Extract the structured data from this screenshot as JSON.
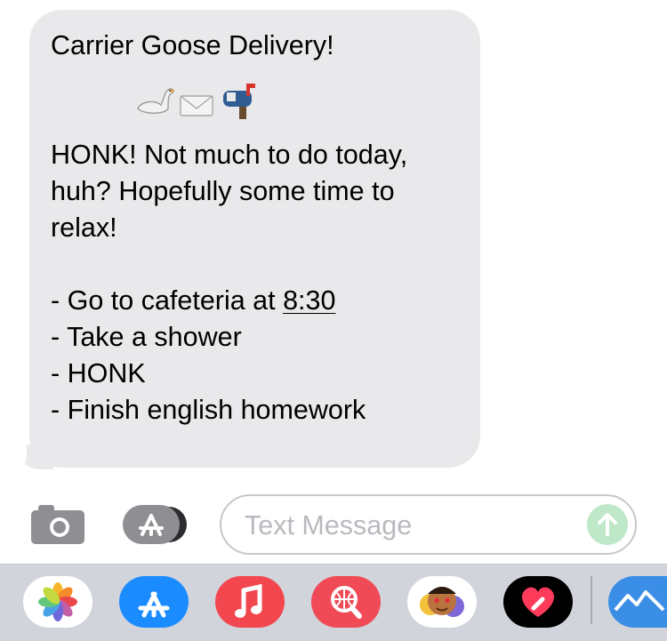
{
  "message": {
    "title": "Carrier Goose Delivery!",
    "emojis": [
      "swan",
      "envelope",
      "open-mailbox"
    ],
    "body_lines": [
      "HONK! Not much to do today,",
      "huh? Hopefully some time to",
      "relax!"
    ],
    "list": {
      "item1_prefix": "- Go to cafeteria at ",
      "item1_time": "8:30",
      "item2": "- Take a shower",
      "item3": "- HONK",
      "item4": "- Finish english homework"
    }
  },
  "composer": {
    "placeholder": "Text Message"
  },
  "colors": {
    "bubble": "#e9e9eb",
    "send_button": "#bfe8c9",
    "app_store_blue": "#1a8cff",
    "music_red": "#f2474f",
    "search_red": "#ef4a55",
    "tray": "#d2d4db"
  },
  "app_drawer": [
    "photos-icon",
    "app-store-icon",
    "music-icon",
    "image-search-icon",
    "memoji-icon",
    "digital-touch-icon",
    "mountain-app-icon"
  ]
}
